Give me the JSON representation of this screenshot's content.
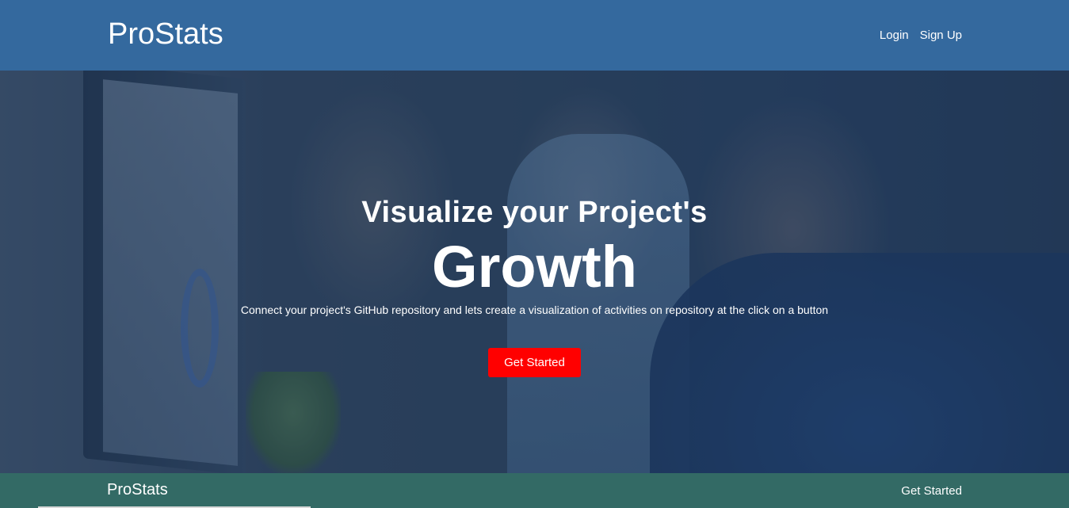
{
  "header": {
    "brand": "ProStats",
    "nav": {
      "login": "Login",
      "signup": "Sign Up"
    }
  },
  "hero": {
    "title": "Visualize your Project's",
    "highlight": "Growth",
    "subtitle": "Connect your project's GitHub repository and lets create a visualization of activities on repository at the click on a button",
    "cta_label": "Get Started"
  },
  "footer": {
    "brand": "ProStats",
    "cta_label": "Get Started"
  },
  "colors": {
    "header_bg": "#34699e",
    "cta_bg": "#ff0000",
    "footer_bg": "#336a65"
  }
}
